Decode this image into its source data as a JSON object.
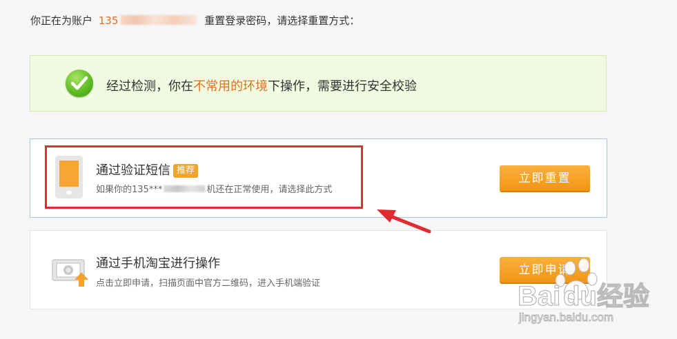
{
  "account_line": {
    "prefix": "你正在为账户",
    "account": "135",
    "suffix": "重置登录密码，请选择重置方式："
  },
  "notice": {
    "before": "经过检测，你在",
    "highlight": "不常用的环境",
    "after": "下操作，需要进行安全校验"
  },
  "options": [
    {
      "title": "通过验证短信",
      "tag": "推荐",
      "desc_before": "如果你的135***",
      "desc_after": "机还在正常使用，请选择此方式",
      "button": "立即重置"
    },
    {
      "title": "通过手机淘宝进行操作",
      "desc": "点击立即申请，扫描页面中官方二维码，进入手机端验证",
      "button": "立即申请"
    }
  ],
  "watermark": {
    "brand": "Bai",
    "brand2": "du",
    "cn": "经验",
    "url": "jingyan.baidu.com"
  },
  "colors": {
    "accent_orange": "#ec6b1c",
    "button_orange": "#f19514",
    "success_green": "#5fbd24",
    "annotation_red": "#e02b30"
  }
}
